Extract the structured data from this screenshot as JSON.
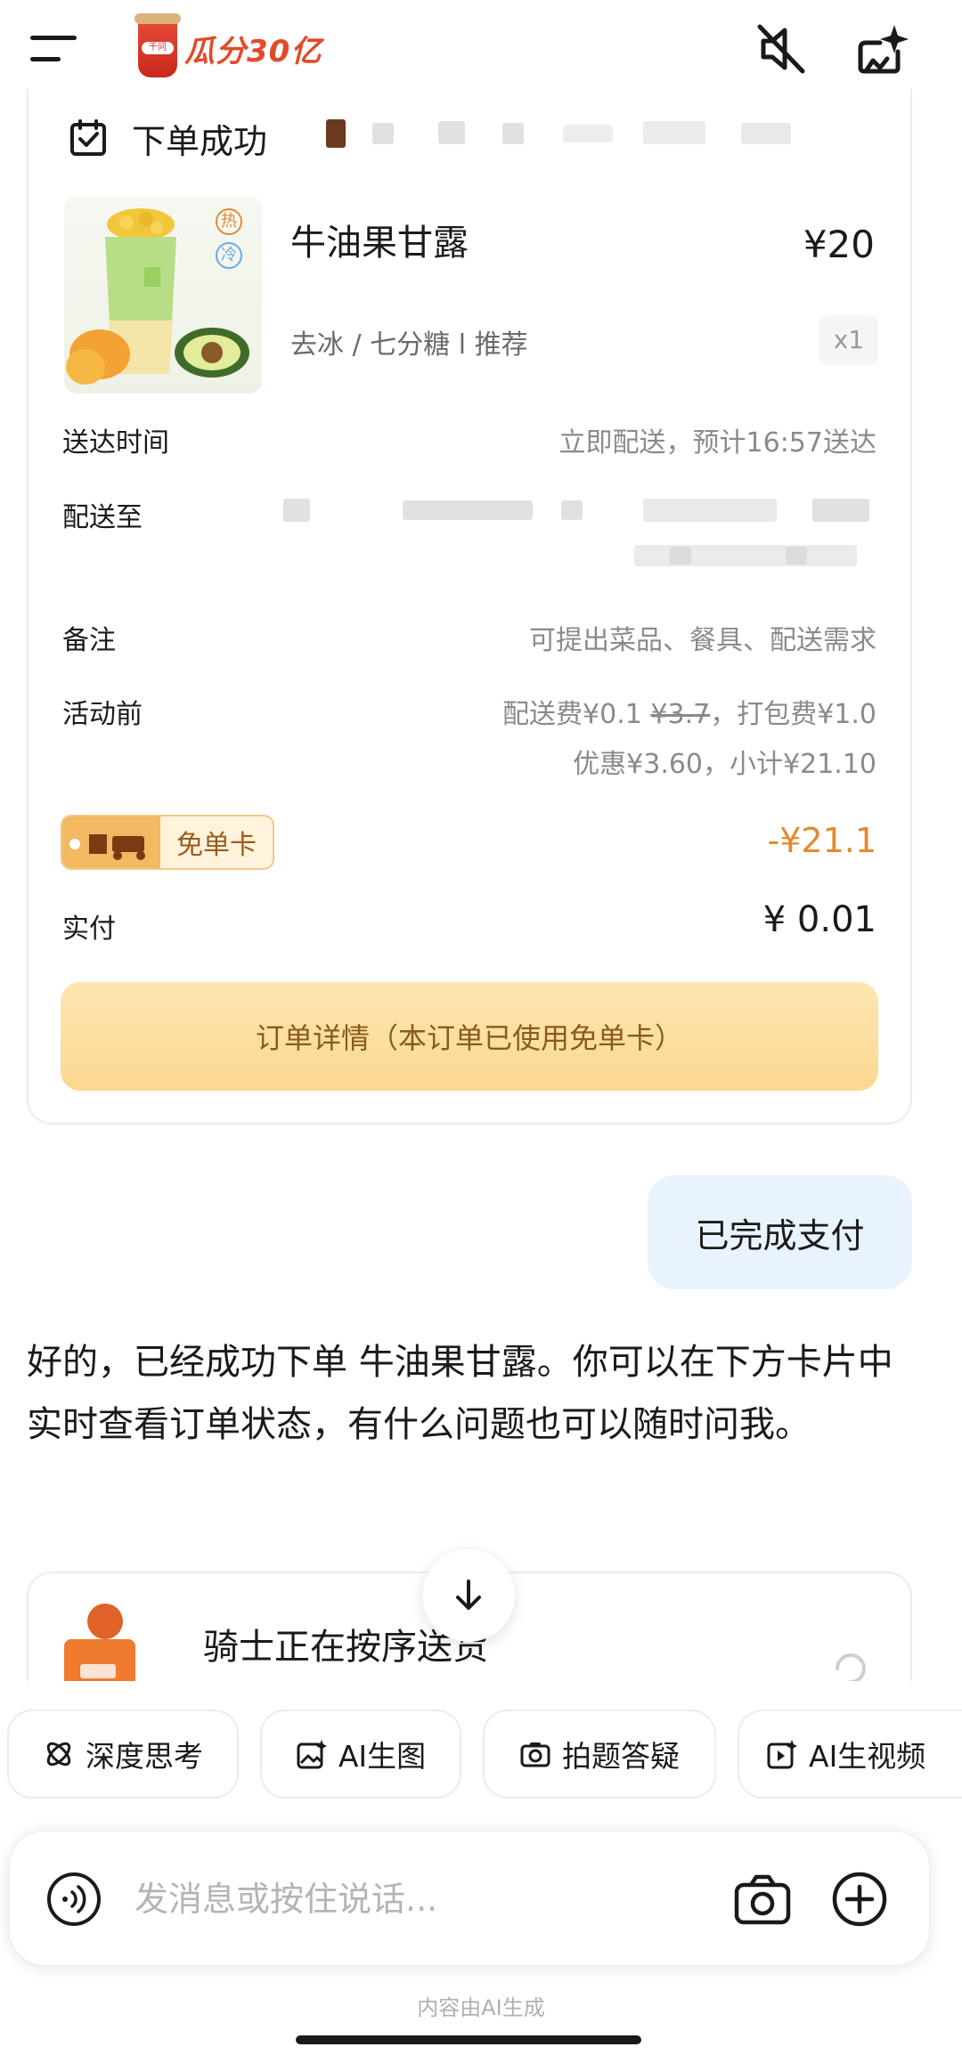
{
  "header": {
    "promo_text": "瓜分30亿",
    "promo_cup_label": "千问",
    "menu_icon": "menu-icon",
    "mute_icon": "speaker-muted-icon",
    "new_chat_icon": "sparkle-new-chat-icon"
  },
  "order": {
    "status_title": "下单成功",
    "product": {
      "name": "牛油果甘露",
      "price": "¥20",
      "options": "去冰 / 七分糖 l 推荐",
      "quantity": "x1",
      "temp_hot": "热",
      "temp_cold": "冷"
    },
    "rows": {
      "delivery_time_label": "送达时间",
      "delivery_time_value": "立即配送，预计16:57送达",
      "deliver_to_label": "配送至",
      "note_label": "备注",
      "note_value": "可提出菜品、餐具、配送需求",
      "before_discount_label": "活动前",
      "fee_line_a": "配送费¥0.1",
      "fee_line_struck": "¥3.7",
      "fee_line_b": "，打包费¥1.0",
      "fee_line_2": "优惠¥3.60，小计¥21.10",
      "free_card_label": "免单卡",
      "free_card_discount": "-¥21.1",
      "paid_label": "实付",
      "paid_value": "¥ 0.01"
    },
    "detail_button": "订单详情（本订单已使用免单卡）"
  },
  "chat": {
    "user_message": "已完成支付",
    "ai_reply": "好的，已经成功下单 牛油果甘露。你可以在下方卡片中实时查看订单状态，有什么问题也可以随时问我。",
    "status_card_text": "骑士正在按序送货"
  },
  "quick_actions": [
    {
      "label": "深度思考",
      "icon": "deep-think-icon"
    },
    {
      "label": "AI生图",
      "icon": "image-gen-icon"
    },
    {
      "label": "拍题答疑",
      "icon": "camera-question-icon"
    },
    {
      "label": "AI生视频",
      "icon": "video-gen-icon"
    }
  ],
  "input": {
    "placeholder": "发消息或按住说话..."
  },
  "disclaimer": "内容由AI生成",
  "colors": {
    "accent_orange": "#e48a2e",
    "user_bubble": "#e9f3fd",
    "detail_button": "#fbd88f"
  }
}
